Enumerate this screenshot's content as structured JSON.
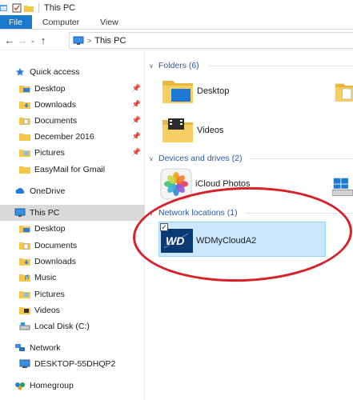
{
  "window": {
    "title": "This PC"
  },
  "ribbon": {
    "tabs": [
      "File",
      "Computer",
      "View"
    ]
  },
  "address": {
    "path": "This PC"
  },
  "navpane": {
    "items": [
      {
        "label": "Quick access",
        "icon": "star-icon",
        "pinned": false
      },
      {
        "label": "Desktop",
        "icon": "desktop-folder-icon",
        "pinned": true
      },
      {
        "label": "Downloads",
        "icon": "downloads-folder-icon",
        "pinned": true
      },
      {
        "label": "Documents",
        "icon": "documents-folder-icon",
        "pinned": true
      },
      {
        "label": "December 2016",
        "icon": "folder-icon",
        "pinned": true
      },
      {
        "label": "Pictures",
        "icon": "pictures-folder-icon",
        "pinned": true
      },
      {
        "label": "EasyMail for Gmail",
        "icon": "folder-icon",
        "pinned": false
      },
      {
        "label": "OneDrive",
        "icon": "onedrive-icon",
        "pinned": false
      },
      {
        "label": "This PC",
        "icon": "this-pc-icon",
        "pinned": false
      },
      {
        "label": "Desktop",
        "icon": "desktop-folder-icon",
        "pinned": false
      },
      {
        "label": "Documents",
        "icon": "documents-folder-icon",
        "pinned": false
      },
      {
        "label": "Downloads",
        "icon": "downloads-folder-icon",
        "pinned": false
      },
      {
        "label": "Music",
        "icon": "music-folder-icon",
        "pinned": false
      },
      {
        "label": "Pictures",
        "icon": "pictures-folder-icon",
        "pinned": false
      },
      {
        "label": "Videos",
        "icon": "videos-folder-icon",
        "pinned": false
      },
      {
        "label": "Local Disk (C:)",
        "icon": "local-disk-icon",
        "pinned": false
      },
      {
        "label": "Network",
        "icon": "network-icon",
        "pinned": false
      },
      {
        "label": "DESKTOP-55DHQP2",
        "icon": "computer-icon",
        "pinned": false
      },
      {
        "label": "Homegroup",
        "icon": "homegroup-icon",
        "pinned": false
      }
    ],
    "selected": "This PC"
  },
  "content": {
    "groups": [
      {
        "header": "Folders (6)",
        "items": [
          "Desktop",
          "Videos"
        ]
      },
      {
        "header": "Devices and drives (2)",
        "items": [
          "iCloud Photos"
        ]
      },
      {
        "header": "Network locations (1)",
        "items": [
          "WDMyCloudA2"
        ]
      }
    ],
    "wd_logo_text": "WD"
  },
  "colors": {
    "file_tab": "#1979ca",
    "selection": "#cce8ff",
    "selection_border": "#99d1ff",
    "nav_selected": "#d9d9d9",
    "group_header": "#2a5aa0",
    "annotation": "#d6202a",
    "folder_yellow": "#f4c74a"
  }
}
